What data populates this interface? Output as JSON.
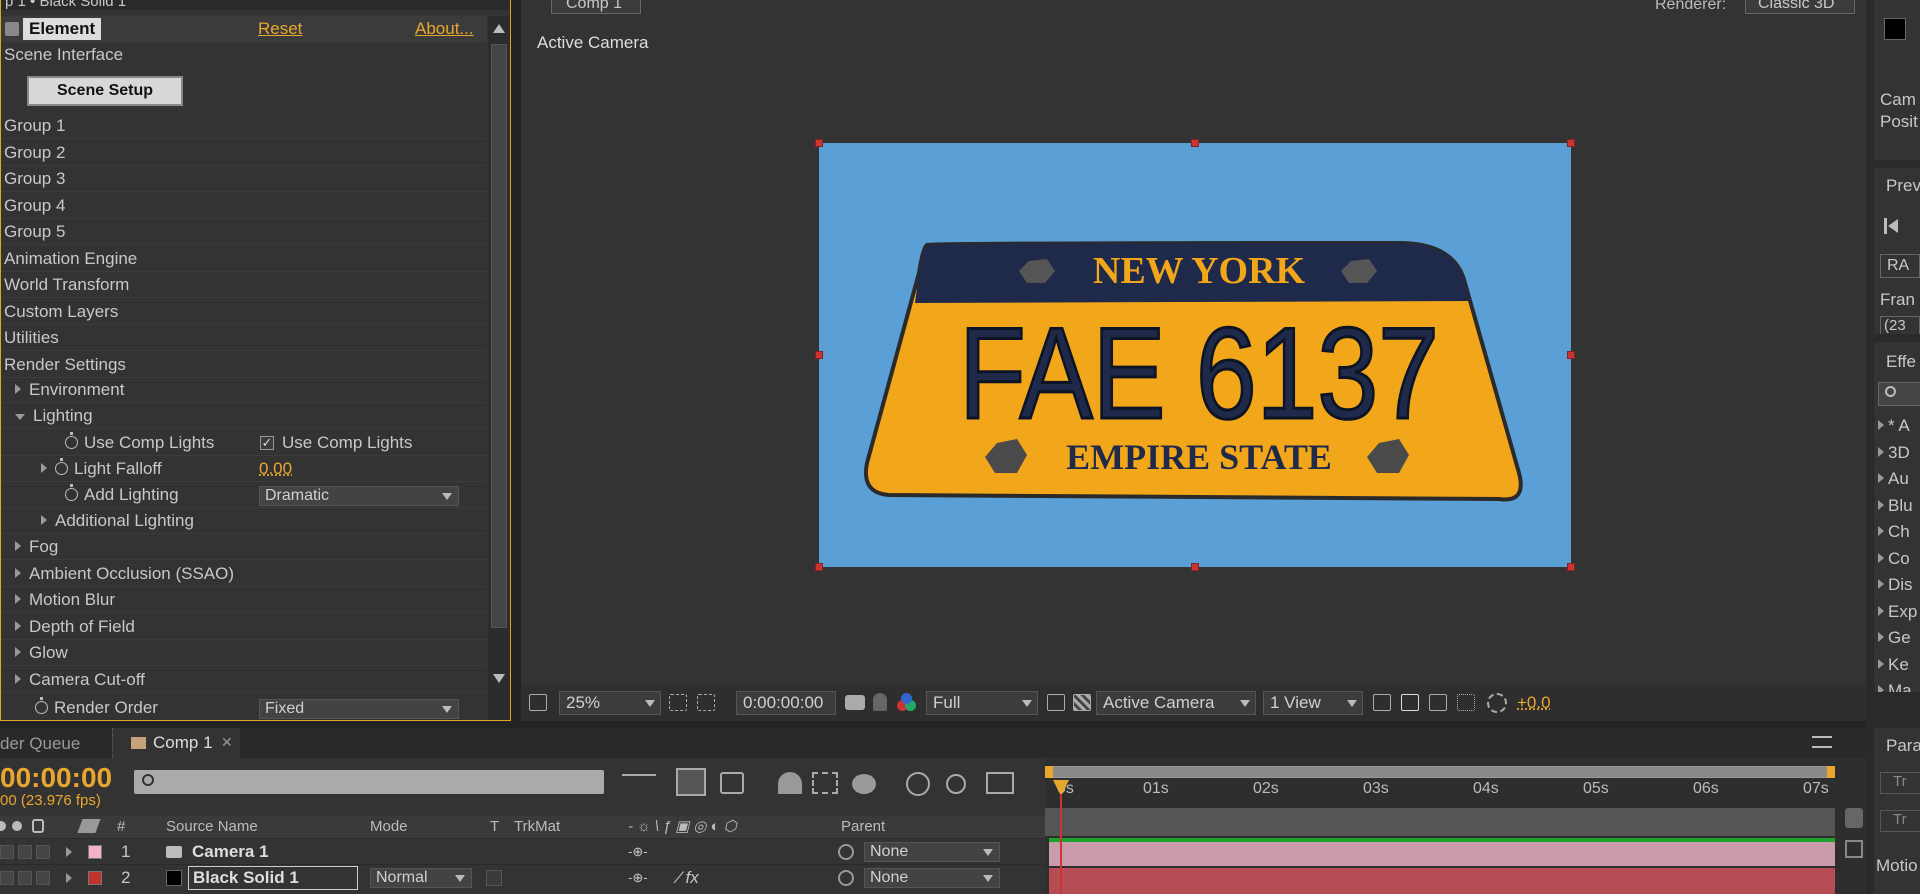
{
  "effect_panel": {
    "title": "p 1 • Black Solid 1",
    "effect_name": "Element",
    "reset": "Reset",
    "about": "About...",
    "scene_interface": "Scene Interface",
    "scene_setup": "Scene Setup",
    "groups": [
      "Group 1",
      "Group 2",
      "Group 3",
      "Group 4",
      "Group 5",
      "Animation Engine",
      "World Transform",
      "Custom Layers",
      "Utilities",
      "Render Settings"
    ],
    "environment": "Environment",
    "lighting": "Lighting",
    "use_comp_lights_label": "Use Comp Lights",
    "use_comp_lights_check": "Use Comp Lights",
    "light_falloff_label": "Light Falloff",
    "light_falloff_value": "0.00",
    "add_lighting_label": "Add Lighting",
    "add_lighting_value": "Dramatic",
    "additional_lighting": "Additional Lighting",
    "sections": [
      "Fog",
      "Ambient Occlusion (SSAO)",
      "Motion Blur",
      "Depth of Field",
      "Glow",
      "Camera Cut-off"
    ],
    "render_order_label": "Render Order",
    "render_order_value": "Fixed"
  },
  "viewer": {
    "comp_tab": "Comp 1",
    "renderer_label": "Renderer:",
    "renderer_value": "Classic 3D",
    "active_camera_label": "Active Camera",
    "plate": {
      "top": "NEW YORK",
      "number": "FAE 6137",
      "bottom": "EMPIRE STATE"
    },
    "toolbar": {
      "zoom": "25%",
      "timecode": "0:00:00:00",
      "resolution": "Full",
      "view": "Active Camera",
      "layout": "1 View",
      "exposure": "+0.0"
    }
  },
  "right_panels": {
    "info": [
      "Cam",
      "Posit"
    ],
    "preview": "Prev",
    "ram": "RA",
    "frame": "Fran",
    "frame_val": "(23",
    "effects": "Effe",
    "effects_list": [
      "* A",
      "3D",
      "Au",
      "Blu",
      "Ch",
      "Co",
      "Dis",
      "Exp",
      "Ge",
      "Ke",
      "Ma"
    ],
    "paragraph": "Para",
    "motion": "Motio",
    "tr1": "Tr",
    "tr2": "Tr"
  },
  "timeline": {
    "render_queue_tab": "der Queue",
    "comp_tab": "Comp 1",
    "timecode": "00:00:00",
    "fps": "00 (23.976 fps)",
    "columns": {
      "num": "#",
      "source": "Source Name",
      "mode": "Mode",
      "t": "T",
      "trkmat": "TrkMat",
      "parent": "Parent"
    },
    "ruler": [
      "0s",
      "01s",
      "02s",
      "03s",
      "04s",
      "05s",
      "06s",
      "07s"
    ],
    "layers": [
      {
        "num": "1",
        "name": "Camera 1",
        "parent": "None",
        "color": "#f2b3c4"
      },
      {
        "num": "2",
        "name": "Black Solid 1",
        "mode": "Normal",
        "parent": "None",
        "color": "#c0332f"
      }
    ]
  },
  "colors": {
    "accent": "#e9a72d",
    "plate_bg": "#5a9fd6",
    "plate_yellow": "#f2a619",
    "plate_navy": "#1f2a4a"
  }
}
